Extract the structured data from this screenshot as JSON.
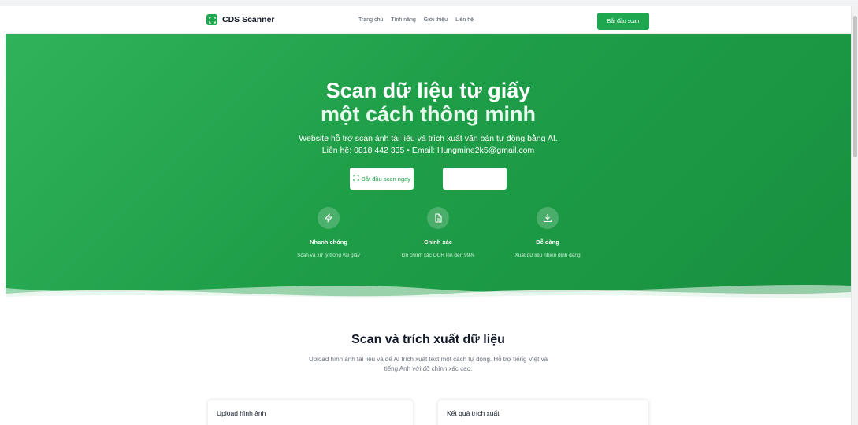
{
  "brand": {
    "name": "CDS Scanner",
    "logo_icon": "scan-icon",
    "accent": "#1fa750"
  },
  "nav": {
    "links": [
      "Trang chủ",
      "Tính năng",
      "Giới thiệu",
      "Liên hệ"
    ],
    "cta": "Bắt đầu scan"
  },
  "hero": {
    "title_line1": "Scan dữ liệu từ giấy",
    "title_line2": "một cách thông minh",
    "description": "Website hỗ trợ scan ảnh tài liệu và trích xuất văn bản tự động bằng AI.",
    "contact": "Liên hệ: 0818 442 335 • Email: Hungmine2k5@gmail.com",
    "primary_button": "Bắt đầu scan ngay",
    "primary_button_icon": "scan-icon",
    "secondary_button": ""
  },
  "features": [
    {
      "icon": "lightning-icon",
      "title": "Nhanh chóng",
      "desc": "Scan và xử lý trong vài giây"
    },
    {
      "icon": "document-icon",
      "title": "Chính xác",
      "desc": "Độ chính xác OCR lên đến 99%"
    },
    {
      "icon": "download-icon",
      "title": "Dễ dàng",
      "desc": "Xuất dữ liệu nhiều định dạng"
    }
  ],
  "section": {
    "title": "Scan và trích xuất dữ liệu",
    "description": "Upload hình ảnh tài liệu và để AI trích xuất text một cách tự động. Hỗ trợ tiếng Việt và tiếng Anh với độ chính xác cao."
  },
  "cards": {
    "upload_title": "Upload hình ảnh",
    "result_title": "Kết quả trích xuất"
  }
}
